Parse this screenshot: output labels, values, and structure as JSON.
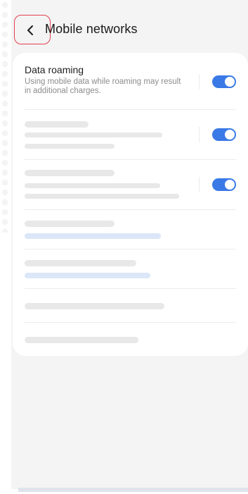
{
  "header": {
    "title": "Mobile networks",
    "back_icon": "chevron-left-icon"
  },
  "settings": {
    "data_roaming": {
      "title": "Data roaming",
      "description": "Using mobile data while roaming may result in additional charges.",
      "enabled": true
    },
    "placeholder_toggles": [
      {
        "enabled": true
      },
      {
        "enabled": true
      }
    ]
  },
  "colors": {
    "accent": "#3a7ae6",
    "highlight_border": "#e2404f",
    "skeleton": "#e8e8e8",
    "skeleton_link": "#dbe7f8",
    "background": "#f4f4f4"
  }
}
